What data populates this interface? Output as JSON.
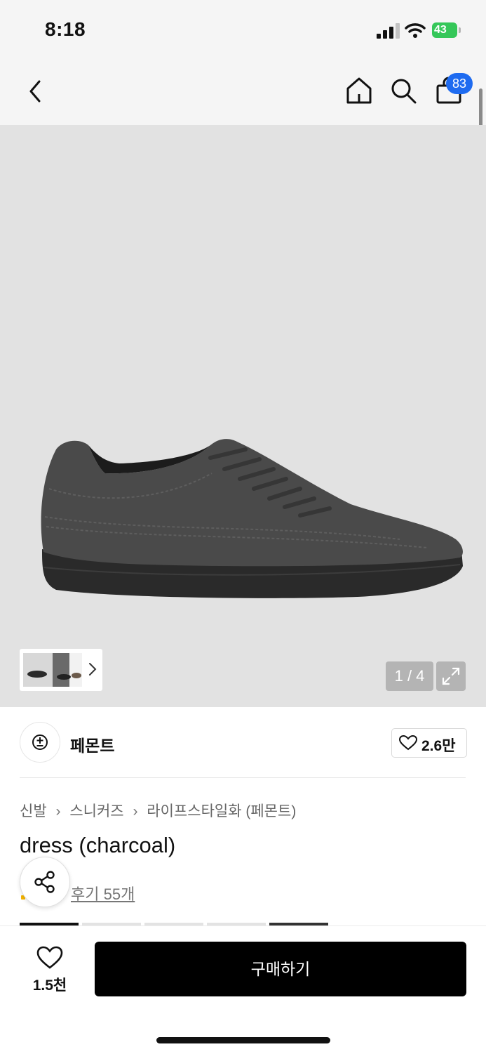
{
  "status_bar": {
    "time": "8:18",
    "battery": "43"
  },
  "nav": {
    "cart_count": "83",
    "icons": [
      "back-icon",
      "home-icon",
      "search-icon",
      "cart-icon"
    ]
  },
  "gallery": {
    "counter": "1 / 4",
    "expand_icon": "expand-icon"
  },
  "brand": {
    "name": "페몬트",
    "likes": "2.6만"
  },
  "breadcrumb": [
    "신발",
    "스니커즈",
    "라이프스타일화 (페몬트)"
  ],
  "product": {
    "title": "dress (charcoal)",
    "reviews": "후기 55개"
  },
  "bottom_bar": {
    "like_count": "1.5천",
    "buy_label": "구매하기"
  },
  "colors": {
    "accent_badge": "#1e6bf0",
    "battery": "#35c759",
    "buy_button": "#000000"
  }
}
